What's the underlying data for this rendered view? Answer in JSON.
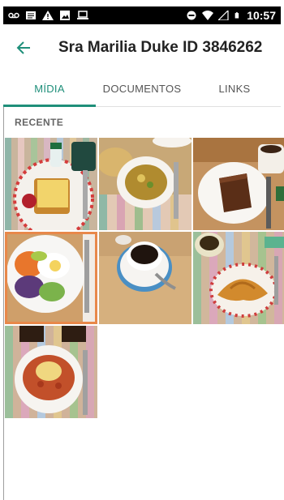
{
  "status_bar": {
    "time": "10:57",
    "icons_left": [
      "voicemail-icon",
      "message-icon",
      "warning-icon",
      "image-icon",
      "laptop-icon"
    ],
    "icons_right": [
      "do-not-disturb-icon",
      "wifi-icon",
      "signal-icon",
      "battery-icon"
    ]
  },
  "appbar": {
    "title": "Sra Marilia Duke ID 3846262",
    "back_icon": "arrow-back-icon",
    "accent_color": "#1f8f7a"
  },
  "tabs": [
    {
      "label": "MÍDIA",
      "active": true
    },
    {
      "label": "DOCUMENTOS",
      "active": false
    },
    {
      "label": "LINKS",
      "active": false
    }
  ],
  "section": {
    "label": "RECENTE"
  },
  "media": [
    {
      "subject": "toast-with-cheese-and-coffee"
    },
    {
      "subject": "soup-bowl-with-bread"
    },
    {
      "subject": "chocolate-cake-with-coffee"
    },
    {
      "subject": "salad-with-fried-egg",
      "selected": true
    },
    {
      "subject": "cup-of-coffee"
    },
    {
      "subject": "croissant-with-coffee"
    },
    {
      "subject": "pasta-with-cheese"
    }
  ]
}
